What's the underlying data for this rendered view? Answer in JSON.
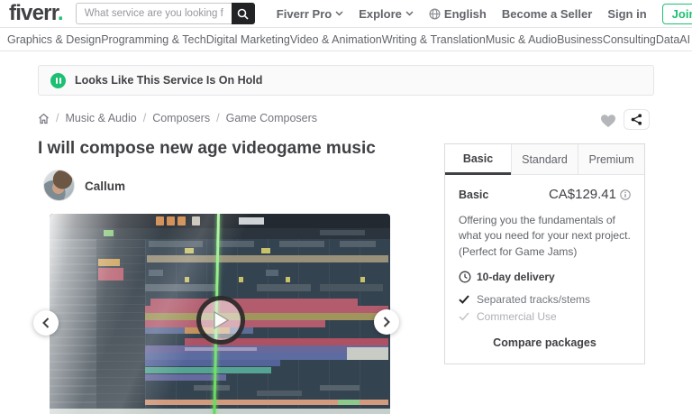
{
  "header": {
    "logo": "fiverr",
    "logo_dot": ".",
    "search_placeholder": "What service are you looking for today?",
    "menu": {
      "fiverr_pro": "Fiverr Pro",
      "explore": "Explore",
      "language": "English",
      "become_seller": "Become a Seller",
      "sign_in": "Sign in",
      "join": "Join"
    }
  },
  "nav": {
    "items": [
      {
        "label": "Graphics & Design"
      },
      {
        "label": "Programming & Tech"
      },
      {
        "label": "Digital Marketing"
      },
      {
        "label": "Video & Animation"
      },
      {
        "label": "Writing & Translation"
      },
      {
        "label": "Music & Audio"
      },
      {
        "label": "Business"
      },
      {
        "label": "Consulting"
      },
      {
        "label": "Data"
      },
      {
        "label": "AI Services"
      }
    ]
  },
  "banner": {
    "text": "Looks Like This Service Is On Hold"
  },
  "breadcrumb": {
    "separator": "/",
    "items": [
      {
        "label": "Music & Audio"
      },
      {
        "label": "Composers"
      },
      {
        "label": "Game Composers"
      }
    ]
  },
  "gig": {
    "title": "I will compose new age videogame music",
    "seller": "Callum"
  },
  "package_card": {
    "tabs": [
      {
        "label": "Basic"
      },
      {
        "label": "Standard"
      },
      {
        "label": "Premium"
      }
    ],
    "selected_tab": "Basic",
    "package_name": "Basic",
    "price": "CA$129.41",
    "description": "Offering you the fundamentals of what you need for your next project. (Perfect for Game Jams)",
    "delivery": "10-day delivery",
    "features": [
      {
        "label": "Separated tracks/stems",
        "included": true
      },
      {
        "label": "Commercial Use",
        "included": false
      }
    ],
    "compare_link": "Compare packages"
  },
  "colors": {
    "accent": "#1dbf73",
    "text_dark": "#404145",
    "text_gray": "#62646a"
  }
}
